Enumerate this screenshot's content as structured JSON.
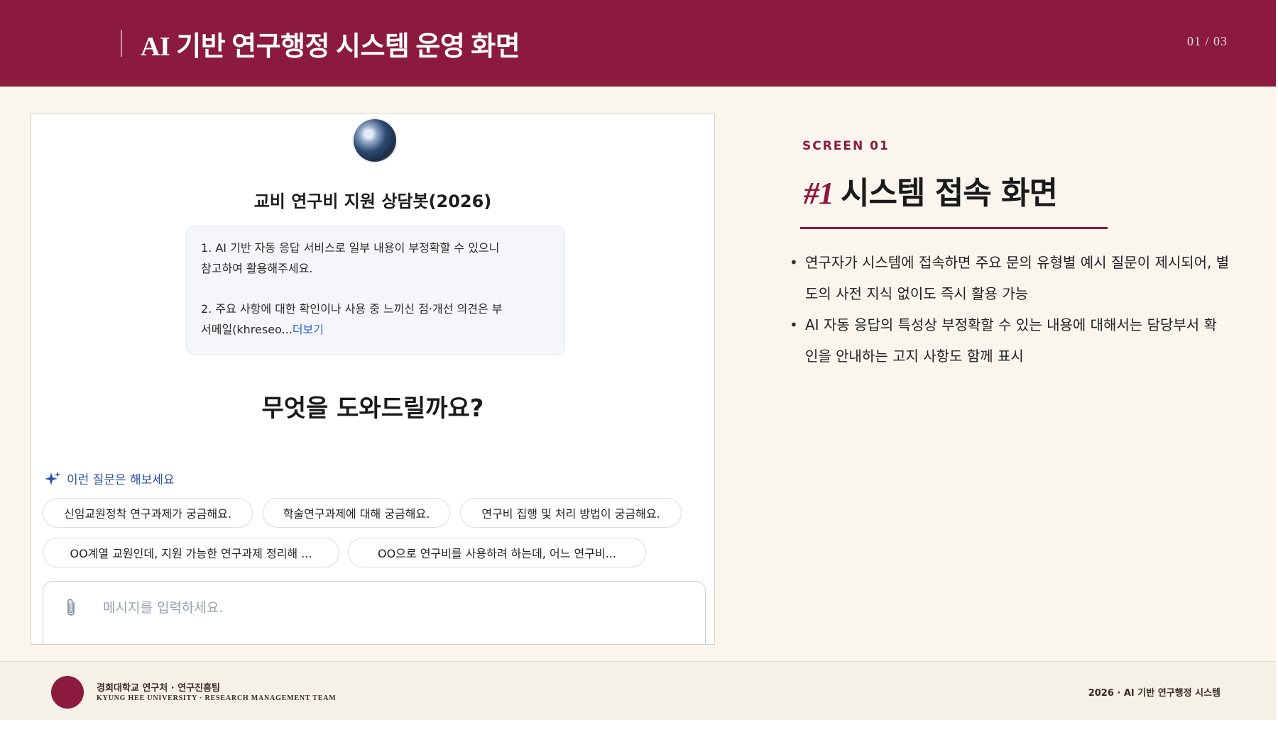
{
  "header": {
    "title": "AI 기반 연구행정 시스템 운영 화면",
    "page_indicator": "01 / 03"
  },
  "chatbot": {
    "bot_name": "교비 연구비 지원 상담봇(2026)",
    "notice": {
      "line1": "1. AI 기반 자동 응답 서비스로 일부 내용이 부정확할 수 있으니",
      "line2": "참고하여 활용해주세요.",
      "line3": "2. 주요 사항에 대한 확인이나 사용 중 느끼신 점·개선 의견은 부",
      "line4_prefix": "서메일(khreseo...",
      "more_link": "더보기"
    },
    "greeting": "무엇을 도와드릴까요?",
    "suggestions_label": "이런 질문은 해보세요",
    "suggestions": [
      "신임교원정착 연구과제가 궁금해요.",
      "학술연구과제에 대해 궁금해요.",
      "연구비 집행 및 처리 방법이 궁금해요.",
      "OO계열 교원인데, 지원 가능한 연구과제 정리해 ...",
      "OO으로 연구비를 사용하려 하는데, 어느 연구비..."
    ],
    "input_placeholder": "메시지를 입력하세요."
  },
  "description": {
    "screen_label": "SCREEN 01",
    "title_number": "#1",
    "title": "시스템 접속 화면",
    "bullets": [
      "연구자가 시스템에 접속하면 주요 문의 유형별 예시 질문이 제시되어, 별도의 사전 지식 없이도 즉시 활용 가능",
      "AI 자동 응답의 특성상 부정확할 수 있는 내용에 대해서는 담당부서 확인을 안내하는 고지 사항도 함께 표시"
    ]
  },
  "footer": {
    "org_kr": "경희대학교 연구처 · 연구진흥팀",
    "org_en": "KYUNG HEE UNIVERSITY · RESEARCH MANAGEMENT TEAM",
    "right_text": "2026 · AI 기반 연구행정 시스템"
  },
  "colors": {
    "brand": "#8b1a3e",
    "background": "#faf6ee",
    "link": "#2f5fd0",
    "suggest_label": "#2b4fa8"
  }
}
